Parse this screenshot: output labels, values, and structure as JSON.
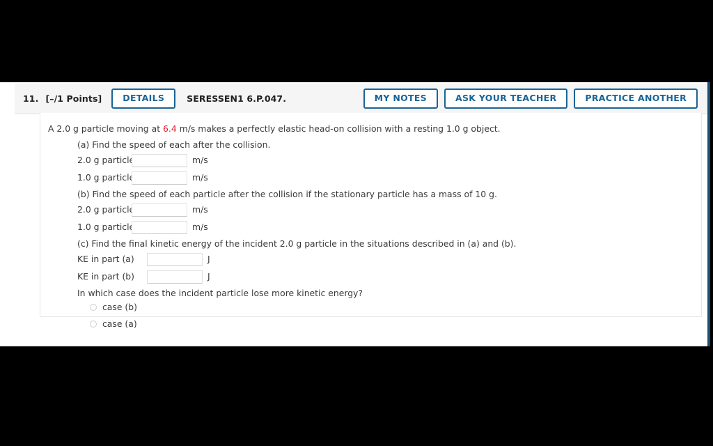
{
  "header": {
    "question_number": "11.",
    "points": "[–/1 Points]",
    "details_label": "DETAILS",
    "question_code": "SERESSEN1 6.P.047.",
    "my_notes_label": "MY NOTES",
    "ask_teacher_label": "ASK YOUR TEACHER",
    "practice_another_label": "PRACTICE ANOTHER",
    "accent_color": "#1a6496",
    "band_color": "#f5f5f5"
  },
  "question": {
    "stem_before": "A 2.0 g particle moving at ",
    "stem_highlight": "6.4",
    "stem_after": " m/s makes a perfectly elastic head-on collision with a resting 1.0 g object.",
    "highlight_color": "#e8192c",
    "part_a_label": "(a) Find the speed of each after the collision.",
    "part_b_label": "(b) Find the speed of each particle after the collision if the stationary particle has a mass of 10 g.",
    "part_c_label": "(c) Find the final kinetic energy of the incident 2.0 g particle in the situations described in (a) and (b).",
    "final_question": "In which case does the incident particle lose more kinetic energy?",
    "answers_a": [
      {
        "label": "2.0 g particle",
        "value": "",
        "placeholder": "",
        "unit": "m/s"
      },
      {
        "label": "1.0 g particle",
        "value": "",
        "placeholder": "",
        "unit": "m/s"
      }
    ],
    "answers_b": [
      {
        "label": "2.0 g particle",
        "value": "",
        "placeholder": "",
        "unit": "m/s"
      },
      {
        "label": "1.0 g particle",
        "value": "",
        "placeholder": "",
        "unit": "m/s"
      }
    ],
    "answers_c": [
      {
        "label": "KE in part (a)",
        "value": "",
        "placeholder": "",
        "unit": "J"
      },
      {
        "label": "KE in part (b)",
        "value": "",
        "placeholder": "",
        "unit": "J"
      }
    ],
    "choices": [
      {
        "label": "case (b)",
        "selected": false
      },
      {
        "label": "case (a)",
        "selected": false
      }
    ]
  }
}
